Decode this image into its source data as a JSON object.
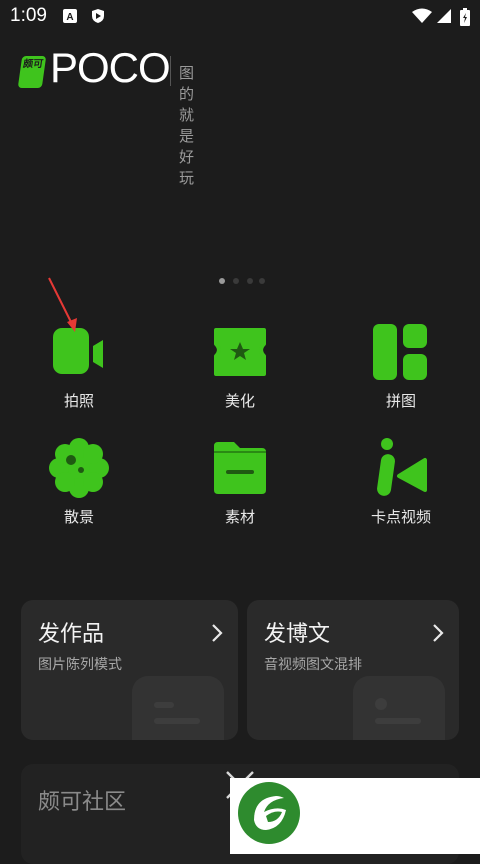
{
  "status_bar": {
    "time": "1:09",
    "icons": [
      "a-badge-icon",
      "shield-icon",
      "wifi-icon",
      "signal-icon",
      "battery-icon"
    ]
  },
  "header": {
    "logo_badge_text": "颇可",
    "logo_text": "POCO",
    "slogan": "图的就是好玩"
  },
  "pager": {
    "count": 4,
    "active_index": 0
  },
  "features": [
    {
      "label": "拍照",
      "icon": "video-camera-icon"
    },
    {
      "label": "美化",
      "icon": "star-ticket-icon"
    },
    {
      "label": "拼图",
      "icon": "collage-icon"
    },
    {
      "label": "散景",
      "icon": "bokeh-flower-icon"
    },
    {
      "label": "素材",
      "icon": "folder-icon"
    },
    {
      "label": "卡点视频",
      "icon": "beat-video-icon"
    }
  ],
  "cards": [
    {
      "title": "发作品",
      "subtitle": "图片陈列模式"
    },
    {
      "title": "发博文",
      "subtitle": "音视频图文混排"
    }
  ],
  "community": {
    "title": "颇可社区"
  },
  "colors": {
    "background": "#1c1c1c",
    "accent_green": "#3fc41d",
    "card_bg": "#2a2a2a",
    "annotation_red": "#e53935"
  }
}
